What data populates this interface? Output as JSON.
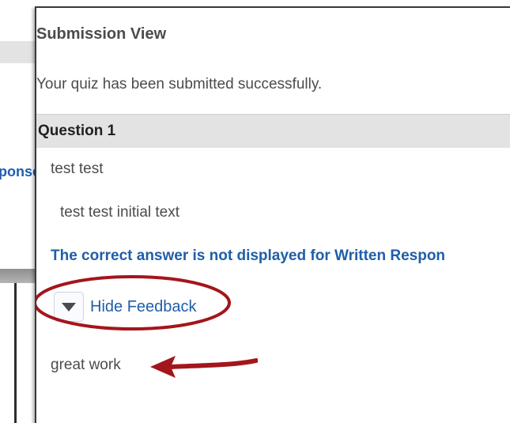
{
  "background_window": {
    "partial_text": "ponse"
  },
  "submission": {
    "title": "Submission View",
    "success_message": "Your quiz has been submitted successfully."
  },
  "question": {
    "label": "Question 1",
    "text": "test test",
    "response": "test test initial text",
    "correct_answer_note": "The correct answer is not displayed for Written Respon"
  },
  "feedback": {
    "toggle_label": "Hide Feedback",
    "toggle_icon": "caret-down-icon",
    "text": "great work"
  },
  "annotations": {
    "highlight_color": "#a3161c",
    "arrow_color": "#a3161c"
  },
  "colors": {
    "link_blue": "#1f5ea8",
    "text_gray": "#494c4e",
    "header_bg": "#e3e3e3"
  }
}
